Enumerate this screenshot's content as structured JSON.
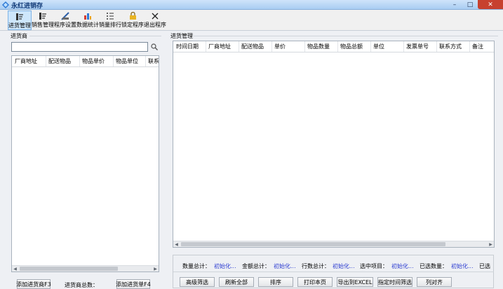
{
  "window": {
    "title": "永红进销存",
    "minimize": "–",
    "maximize": "□",
    "close": "✕"
  },
  "toolbar": {
    "items": [
      {
        "label": "进货管理",
        "icon": "purchase-icon",
        "active": true
      },
      {
        "label": "销售管理",
        "icon": "sales-icon",
        "active": false
      },
      {
        "label": "程序设置",
        "icon": "settings-icon",
        "active": false
      },
      {
        "label": "数据统计",
        "icon": "chart-icon",
        "active": false
      },
      {
        "label": "销量排行",
        "icon": "ranking-icon",
        "active": false
      },
      {
        "label": "锁定程序",
        "icon": "lock-icon",
        "active": false
      },
      {
        "label": "退出程序",
        "icon": "close-icon",
        "active": false
      }
    ]
  },
  "supplier_panel": {
    "title": "进货商",
    "search": {
      "value": "",
      "placeholder": ""
    },
    "columns": [
      "厂商地址",
      "配送物品",
      "物品单价",
      "物品单位",
      "联系"
    ],
    "add_supplier_button": "添加进货商F3",
    "total_label": "进货商总数：",
    "add_order_button": "添加进货单F4"
  },
  "purchase_panel": {
    "title": "进货管理",
    "columns": [
      "时间日期",
      "厂商地址",
      "配送物品",
      "单价",
      "物品数量",
      "物品总额",
      "单位",
      "发票单号",
      "联系方式",
      "备注"
    ],
    "stats": [
      {
        "label": "数量总计：",
        "value": "初始化..."
      },
      {
        "label": "金额总计：",
        "value": "初始化..."
      },
      {
        "label": "行数总计：",
        "value": "初始化..."
      },
      {
        "label": "选中项目：",
        "value": "初始化..."
      },
      {
        "label": "已选数量：",
        "value": "初始化..."
      },
      {
        "label": "已选",
        "value": ""
      }
    ],
    "buttons": [
      "高级筛选",
      "刷新全部",
      "排序",
      "打印本页",
      "导出到EXCEL",
      "指定时间筛选",
      "列对齐"
    ]
  },
  "colors": {
    "accent": "#cde6fb",
    "stat_value": "#2a3ad0",
    "close_button": "#c7412f"
  }
}
